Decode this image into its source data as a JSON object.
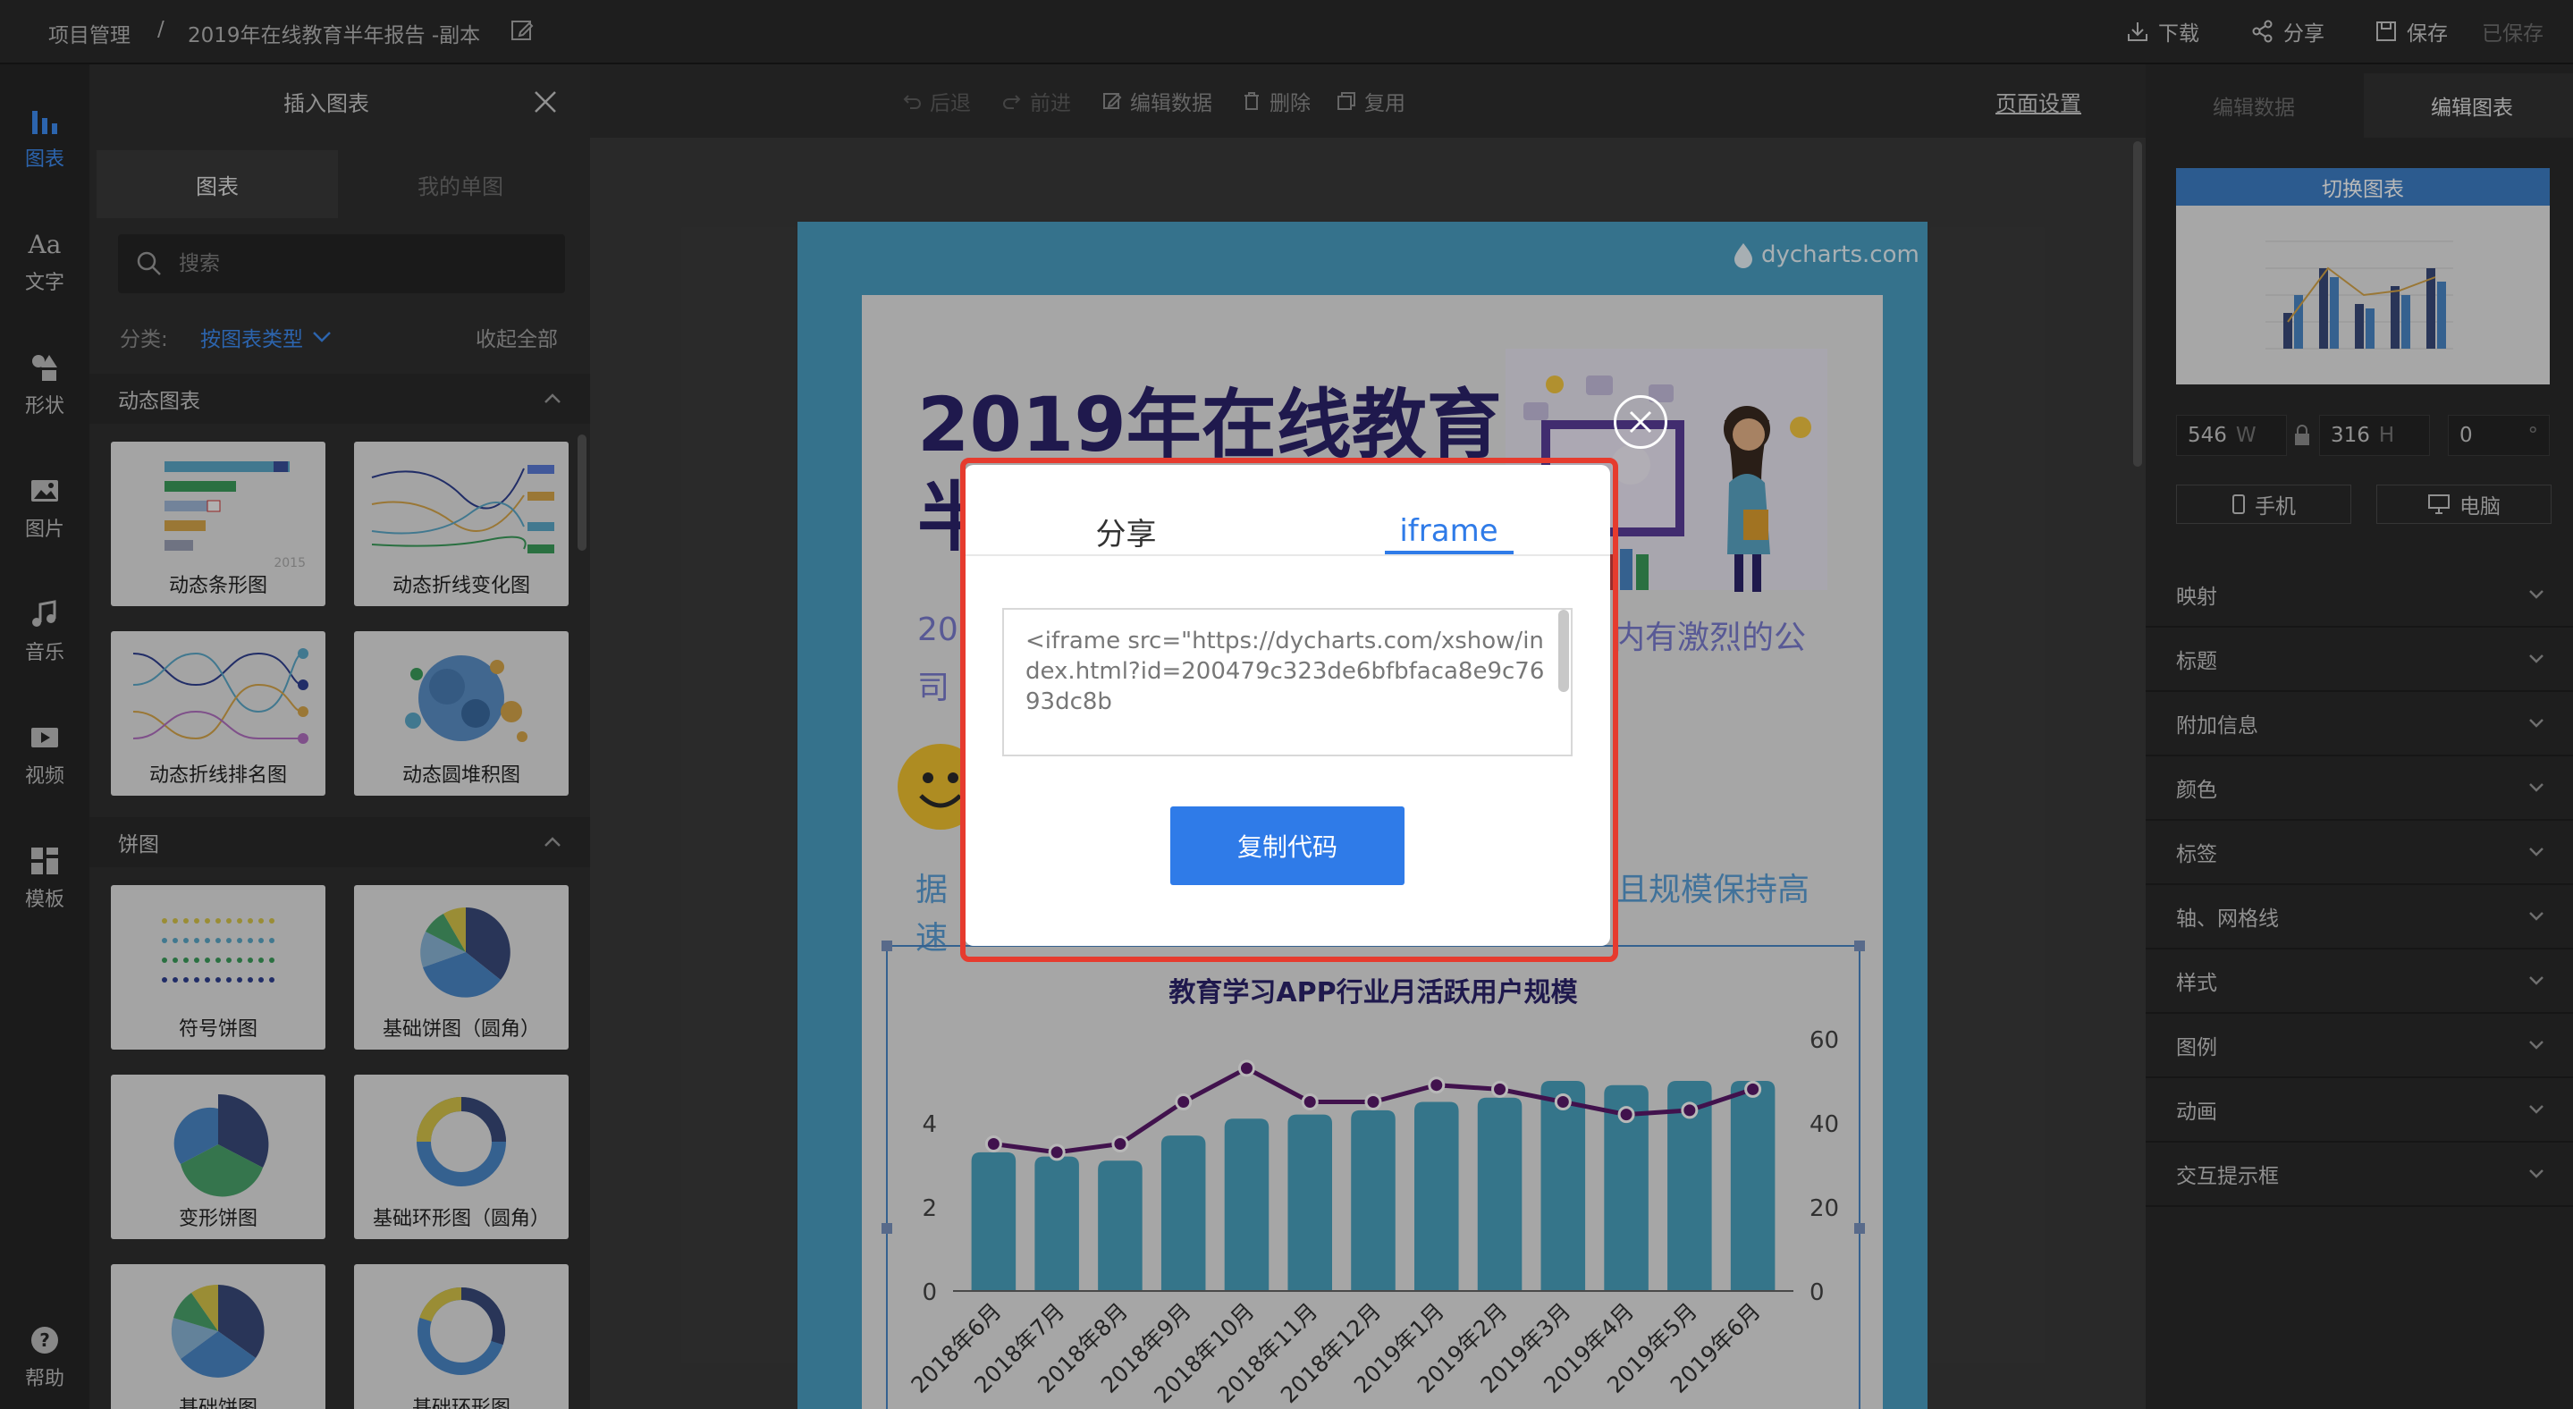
{
  "topbar": {
    "breadcrumb_root": "项目管理",
    "breadcrumb_sep": "/",
    "doc_title": "2019年在线教育半年报告 -副本",
    "download": "下载",
    "share": "分享",
    "save": "保存",
    "saved_status": "已保存"
  },
  "rail": {
    "items": [
      {
        "label": "图表",
        "icon": "bar-chart-icon"
      },
      {
        "label": "文字",
        "icon": "text-icon"
      },
      {
        "label": "形状",
        "icon": "shapes-icon"
      },
      {
        "label": "图片",
        "icon": "image-icon"
      },
      {
        "label": "音乐",
        "icon": "music-icon"
      },
      {
        "label": "视频",
        "icon": "video-icon"
      },
      {
        "label": "模板",
        "icon": "template-icon"
      }
    ],
    "help": "帮助"
  },
  "insert_panel": {
    "title": "插入图表",
    "tabs": [
      "图表",
      "我的单图"
    ],
    "search_placeholder": "搜索",
    "category_label": "分类:",
    "category_value": "按图表类型",
    "collapse_all": "收起全部",
    "section_dynamic": "动态图表",
    "section_pie": "饼图",
    "cards": [
      "动态条形图",
      "动态折线变化图",
      "动态折线排名图",
      "动态圆堆积图",
      "符号饼图",
      "基础饼图（圆角）",
      "变形饼图",
      "基础环形图（圆角）",
      "基础饼图",
      "基础环形图"
    ],
    "thumb_year": "2015"
  },
  "toolbar": {
    "undo": "后退",
    "redo": "前进",
    "edit_data": "编辑数据",
    "delete": "删除",
    "reuse": "复用",
    "page_settings": "页面设置"
  },
  "report": {
    "watermark": "dycharts.com",
    "title_line1": "2019年在线教育",
    "title_line2_partial": "半",
    "sub_left": "20",
    "sub_right": "内有激烈的公",
    "sub_left2": "司",
    "line3_left": "据",
    "line3_right": "且规模保持高",
    "line4_left": "速"
  },
  "chart_data": {
    "type": "bar",
    "title": "教育学习APP行业月活跃用户规模",
    "categories": [
      "2018年6月",
      "2018年7月",
      "2018年8月",
      "2018年9月",
      "2018年10月",
      "2018年11月",
      "2018年12月",
      "2019年1月",
      "2019年2月",
      "2019年3月",
      "2019年4月",
      "2019年5月",
      "2019年6月"
    ],
    "series": [
      {
        "values": [
          3.3,
          3.2,
          3.1,
          3.7,
          4.1,
          4.2,
          4.3,
          4.5,
          4.6,
          5.0,
          4.9,
          5.0,
          5.0
        ],
        "color": "#4aa3bf"
      },
      {
        "values": [
          35,
          33,
          35,
          45,
          53,
          45,
          45,
          49,
          48,
          45,
          42,
          43,
          48
        ],
        "color": "#5b1a6b"
      }
    ],
    "y_left_ticks": [
      "0",
      "2",
      "4"
    ],
    "y_right_ticks": [
      "0",
      "20",
      "40",
      "60"
    ],
    "y_left_range": [
      0,
      6
    ],
    "y_right_range": [
      0,
      60
    ]
  },
  "right_panel": {
    "tabs": [
      "编辑数据",
      "编辑图表"
    ],
    "switch_chart": "切换图表",
    "width": "546",
    "width_unit": "W",
    "height": "316",
    "height_unit": "H",
    "rotation": "0",
    "rotation_unit": "°",
    "mobile": "手机",
    "desktop": "电脑",
    "sections": [
      "映射",
      "标题",
      "附加信息",
      "颜色",
      "标签",
      "轴、网格线",
      "样式",
      "图例",
      "动画",
      "交互提示框"
    ]
  },
  "modal": {
    "tabs": [
      "分享",
      "iframe"
    ],
    "active_tab": "iframe",
    "code": "<iframe src=\"https://dycharts.com/xshow/index.html?id=200479c323de6bfbfaca8e9c7693dc8b",
    "copy_button": "复制代码"
  },
  "colors": {
    "accent": "#3d8bf0",
    "modal_button": "#2f7be8",
    "highlight": "#e63b2e",
    "bar": "#4aa3bf",
    "line": "#5b1a6b"
  }
}
